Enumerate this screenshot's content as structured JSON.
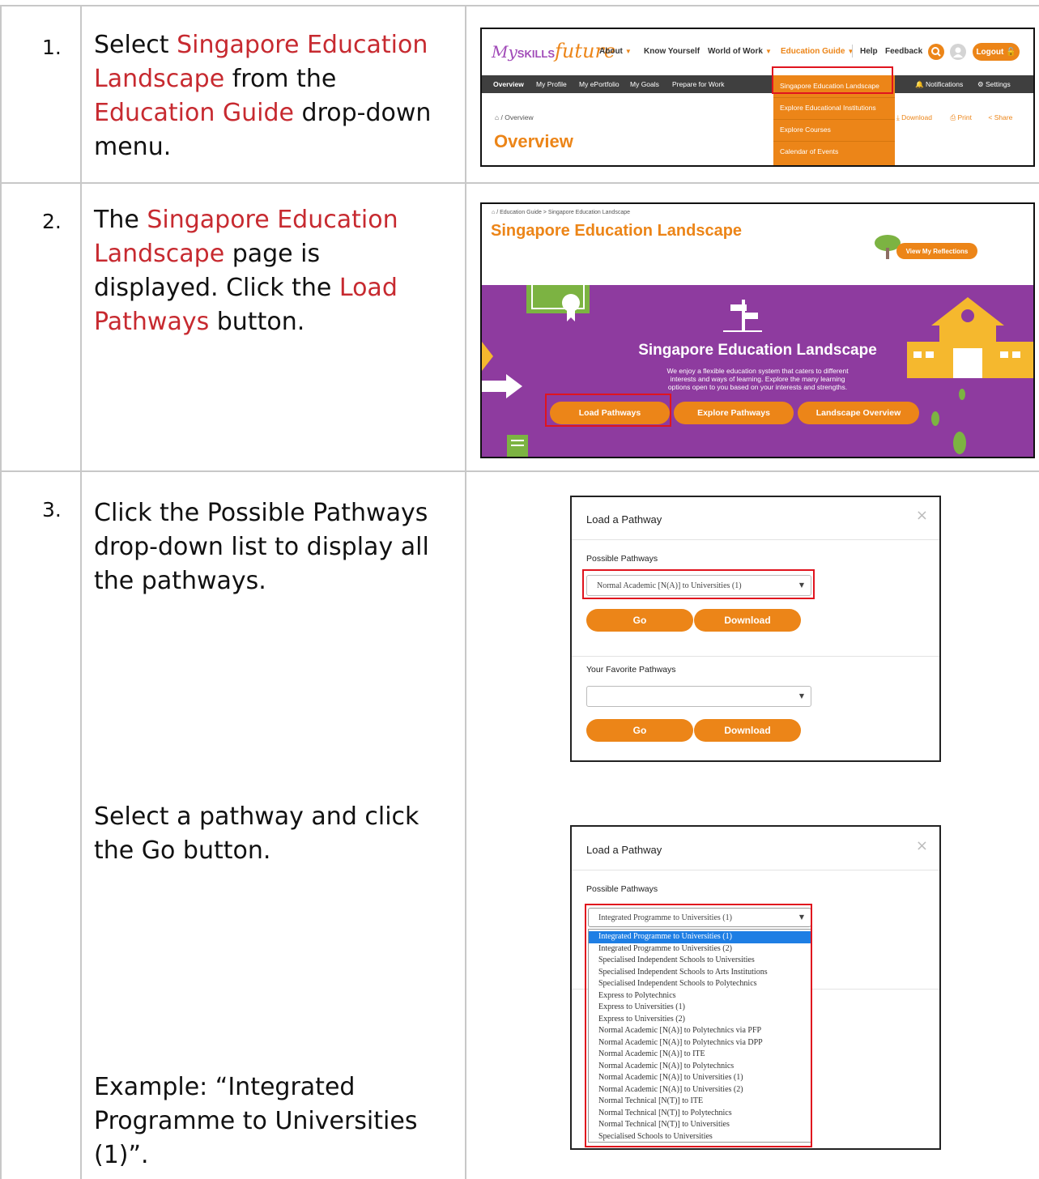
{
  "rows": [
    {
      "number": "1.",
      "instruction": {
        "p1": "Select ",
        "h1": "Singapore Education Landscape",
        "p2": " from the ",
        "h2": "Education Guide",
        "p3": " drop-down menu."
      }
    },
    {
      "number": "2.",
      "instruction": {
        "p1": "The ",
        "h1": "Singapore Education Landscape",
        "p2": " page is displayed. Click the ",
        "h2": "Load Pathways",
        "p3": " button."
      }
    },
    {
      "number": "3.",
      "instruction_a": "Click the Possible Pathways drop-down list to display all the pathways.",
      "instruction_b": "Select a pathway and click the Go button.",
      "instruction_c": "Example: “Integrated Programme to Universities (1)”."
    }
  ],
  "screenshot1": {
    "logo_my": "My",
    "logo_skills": "SKILLS",
    "logo_future": "future",
    "nav": {
      "about": "About",
      "know_yourself": "Know Yourself",
      "world_of_work": "World of Work",
      "education_guide": "Education Guide",
      "help": "Help",
      "feedback": "Feedback",
      "logout": "Logout"
    },
    "subnav": {
      "overview": "Overview",
      "my_profile": "My Profile",
      "my_eportfolio": "My ePortfolio",
      "my_goals": "My Goals",
      "prepare_for_work": "Prepare for Work",
      "notifications": "Notifications",
      "settings": "Settings"
    },
    "dropdown": [
      "Singapore Education Landscape",
      "Explore Educational Institutions",
      "Explore Courses",
      "Calendar of Events"
    ],
    "breadcrumb": "/  Overview",
    "actions": {
      "download": "Download",
      "print": "Print",
      "share": "Share"
    },
    "page_title": "Overview"
  },
  "screenshot2": {
    "breadcrumb": "/  Education Guide  >  Singapore Education Landscape",
    "page_title": "Singapore Education Landscape",
    "reflections_button": "View My Reflections",
    "banner_title": "Singapore Education Landscape",
    "banner_text": [
      "We enjoy a flexible education system that caters to different",
      "interests and ways of learning. Explore the many learning",
      "options open to you based on your interests and strengths."
    ],
    "buttons": {
      "load": "Load Pathways",
      "explore": "Explore Pathways",
      "overview": "Landscape Overview"
    }
  },
  "modal1": {
    "title": "Load a Pathway",
    "close": "×",
    "possible_label": "Possible Pathways",
    "possible_value": "Normal Academic [N(A)] to Universities (1)",
    "go": "Go",
    "download": "Download",
    "favorite_label": "Your Favorite Pathways",
    "favorite_value": ""
  },
  "modal2": {
    "title": "Load a Pathway",
    "close": "×",
    "possible_label": "Possible Pathways",
    "possible_value": "Integrated Programme to Universities (1)",
    "selected_index": 0,
    "options": [
      "Integrated Programme to Universities (1)",
      "Integrated Programme to Universities (2)",
      "Specialised Independent Schools to Universities",
      "Specialised Independent Schools to Arts Institutions",
      "Specialised Independent Schools to Polytechnics",
      "Express to Polytechnics",
      "Express to Universities (1)",
      "Express to Universities (2)",
      "Normal Academic [N(A)] to Polytechnics via PFP",
      "Normal Academic [N(A)] to Polytechnics via DPP",
      "Normal Academic [N(A)] to ITE",
      "Normal Academic [N(A)] to Polytechnics",
      "Normal Academic [N(A)] to Universities (1)",
      "Normal Academic [N(A)] to Universities (2)",
      "Normal Technical [N(T)] to ITE",
      "Normal Technical [N(T)] to Polytechnics",
      "Normal Technical [N(T)] to Universities",
      "Specialised Schools to Universities"
    ]
  },
  "colors": {
    "highlight_text": "#c72a30",
    "brand_orange": "#ec8518",
    "banner_purple": "#8e3b9f",
    "annotation_red": "#e0141e",
    "option_selected": "#1e7ee4"
  }
}
